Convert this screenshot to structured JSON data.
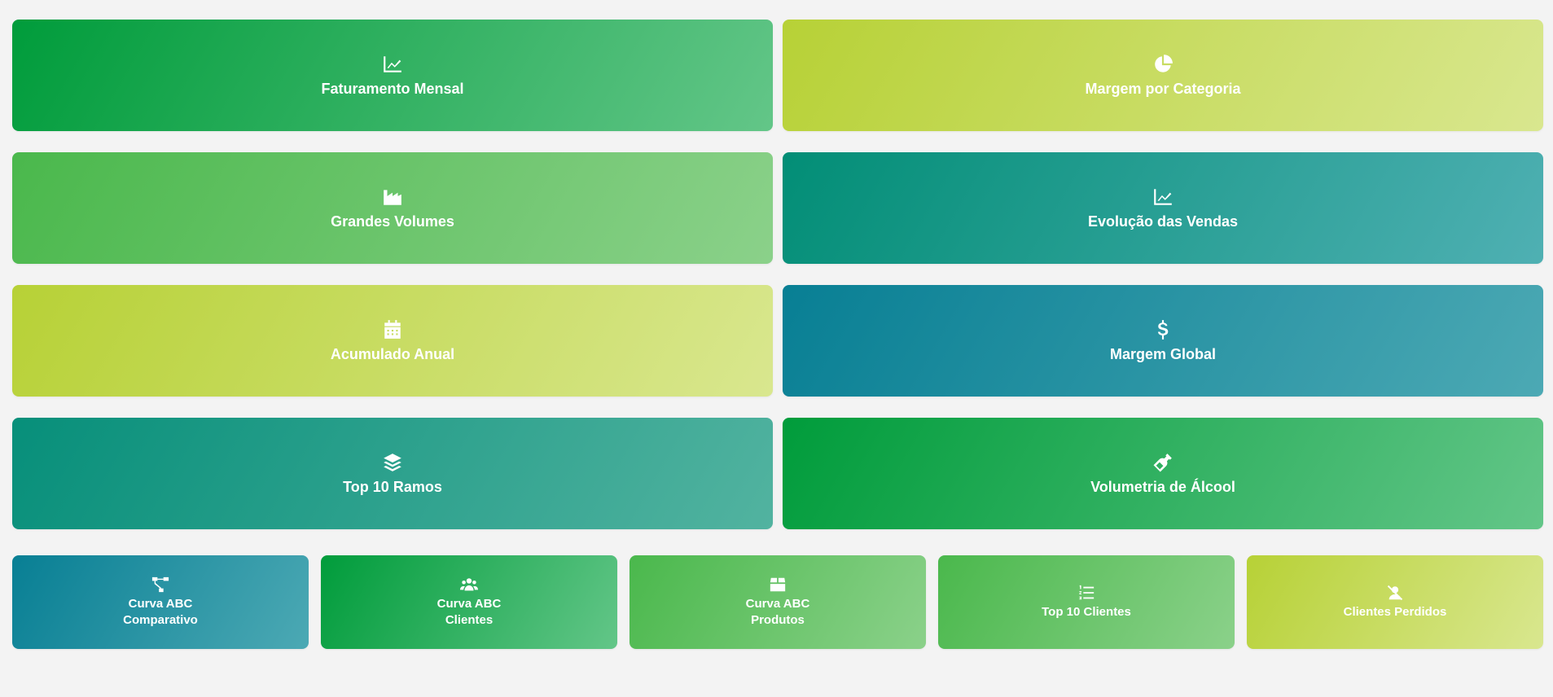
{
  "tiles_large": [
    {
      "label": "Faturamento Mensal",
      "icon": "chart-line-icon",
      "color": "#009c3b"
    },
    {
      "label": "Margem por Categoria",
      "icon": "pie-chart-icon",
      "color": "#b7d136"
    },
    {
      "label": "Grandes Volumes",
      "icon": "industry-icon",
      "color": "#4ab84c"
    },
    {
      "label": "Evolução das Vendas",
      "icon": "chart-line-icon",
      "color": "#028e76"
    },
    {
      "label": "Acumulado Anual",
      "icon": "calendar-icon",
      "color": "#b7d136"
    },
    {
      "label": "Margem Global",
      "icon": "dollar-icon",
      "color": "#087f94"
    },
    {
      "label": "Top 10 Ramos",
      "icon": "layers-icon",
      "color": "#078f7a"
    },
    {
      "label": "Volumetria de Álcool",
      "icon": "bottle-icon",
      "color": "#009c3b"
    }
  ],
  "tiles_small": [
    {
      "line1": "Curva ABC",
      "line2": "Comparativo",
      "icon": "sitemap-icon",
      "color": "#087f94"
    },
    {
      "line1": "Curva ABC",
      "line2": "Clientes",
      "icon": "users-icon",
      "color": "#009c3b"
    },
    {
      "line1": "Curva ABC",
      "line2": "Produtos",
      "icon": "box-icon",
      "color": "#4ab84c"
    },
    {
      "line1": "Top 10 Clientes",
      "line2": "",
      "icon": "list-ol-icon",
      "color": "#4ab84c"
    },
    {
      "line1": "Clientes Perdidos",
      "line2": "",
      "icon": "user-slash-icon",
      "color": "#b7d136"
    }
  ]
}
